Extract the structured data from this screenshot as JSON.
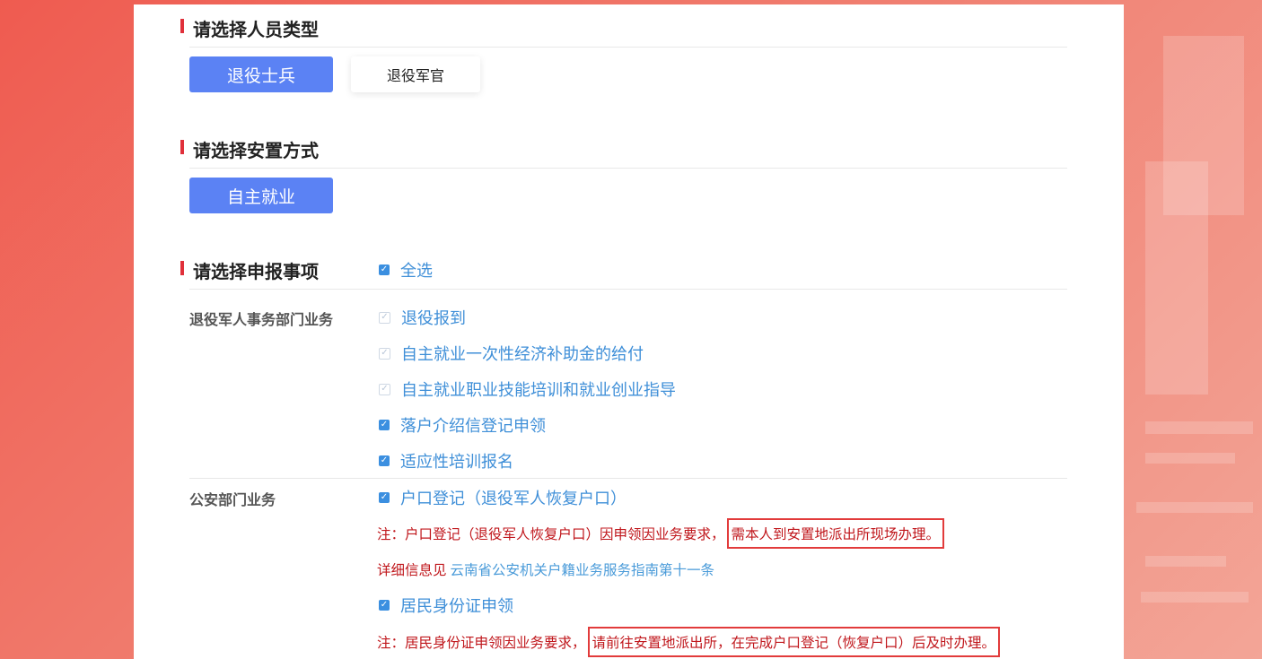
{
  "sections": {
    "personnel_type": {
      "title": "请选择人员类型",
      "options": [
        {
          "label": "退役士兵",
          "selected": true
        },
        {
          "label": "退役军官",
          "selected": false
        }
      ]
    },
    "placement_method": {
      "title": "请选择安置方式",
      "options": [
        {
          "label": "自主就业",
          "selected": true
        }
      ]
    },
    "declaration_items": {
      "title": "请选择申报事项",
      "select_all_label": "全选",
      "groups": [
        {
          "label": "退役军人事务部门业务",
          "items": [
            {
              "label": "退役报到",
              "state": "disabled-checked"
            },
            {
              "label": "自主就业一次性经济补助金的给付",
              "state": "disabled-checked"
            },
            {
              "label": "自主就业职业技能培训和就业创业指导",
              "state": "disabled-checked"
            },
            {
              "label": "落户介绍信登记申领",
              "state": "checked"
            },
            {
              "label": "适应性培训报名",
              "state": "checked"
            }
          ]
        },
        {
          "label": "公安部门业务",
          "items": [
            {
              "label": "户口登记（退役军人恢复户口）",
              "state": "checked"
            },
            {
              "label": "居民身份证申领",
              "state": "checked"
            }
          ],
          "notes": {
            "hukou_prefix": "注：户口登记（退役军人恢复户口）因申领因业务要求，",
            "hukou_boxed": "需本人到安置地派出所现场办理。",
            "detail_prefix": "详细信息见",
            "detail_link": "云南省公安机关户籍业务服务指南第十一条",
            "idcard_prefix": "注：居民身份证申领因业务要求，",
            "idcard_boxed": "请前往安置地派出所，在完成户口登记（恢复户口）后及时办理。"
          }
        }
      ]
    }
  },
  "colors": {
    "primary_button": "#5b82f4",
    "accent_bar": "#e0303a",
    "checkbox": "#3b8fe0",
    "link_text": "#3f8fd8",
    "warning_text": "#c0171c",
    "highlight_border": "#e23b3b",
    "background_gradient_start": "#ef5b50"
  },
  "icons": {
    "checkbox_checked": "check-icon"
  }
}
